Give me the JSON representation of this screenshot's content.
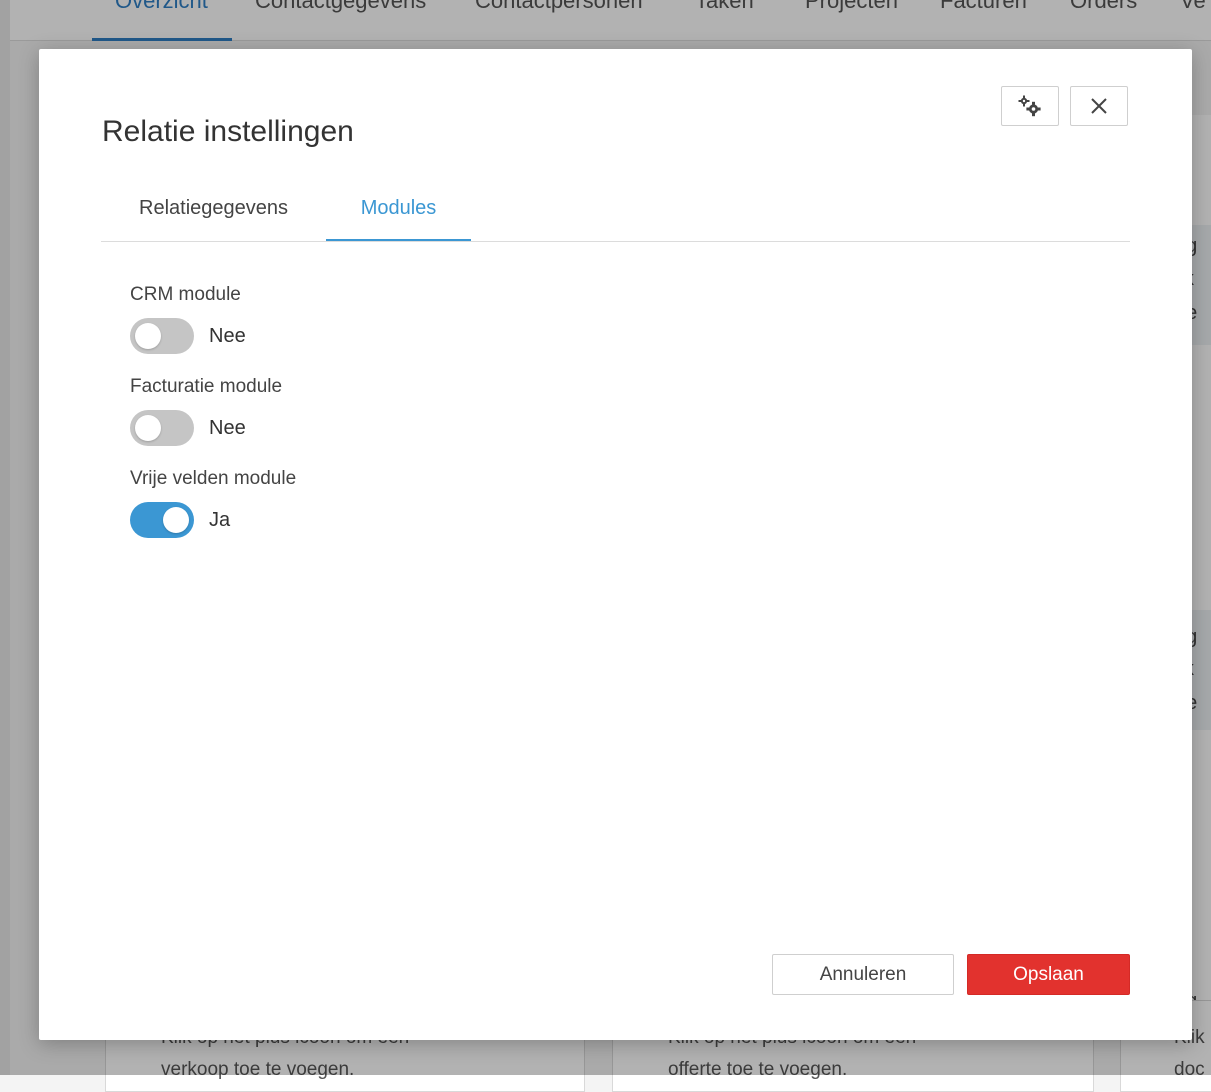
{
  "background": {
    "nav_tabs": [
      "Overzicht",
      "Contactgegevens",
      "Contactpersonen",
      "Taken",
      "Projecten",
      "Facturen",
      "Orders",
      "Ve"
    ],
    "active_tab": "Overzicht",
    "cards": [
      {
        "line1": "Klik op het plus icoon om een",
        "line2": "verkoop toe te voegen."
      },
      {
        "line1": "Klik op het plus icoon om een",
        "line2": "offerte toe te voegen."
      },
      {
        "line1": "Klik",
        "line2": "doc"
      }
    ],
    "right_fragments": [
      "og",
      "lik",
      "pe",
      "og",
      "lik",
      "pe",
      "og"
    ]
  },
  "modal": {
    "title": "Relatie instellingen",
    "tabs": [
      {
        "label": "Relatiegegevens",
        "active": false
      },
      {
        "label": "Modules",
        "active": true
      }
    ],
    "modules": [
      {
        "label": "CRM module",
        "enabled": false,
        "value_text": "Nee"
      },
      {
        "label": "Facturatie module",
        "enabled": false,
        "value_text": "Nee"
      },
      {
        "label": "Vrije velden module",
        "enabled": true,
        "value_text": "Ja"
      }
    ],
    "cancel_label": "Annuleren",
    "save_label": "Opslaan"
  },
  "colors": {
    "accent": "#3b97d3",
    "primary_button": "#e2322e",
    "toggle_off": "#c5c5c5"
  },
  "icons": {
    "settings": "gears-icon",
    "close": "close-icon"
  }
}
